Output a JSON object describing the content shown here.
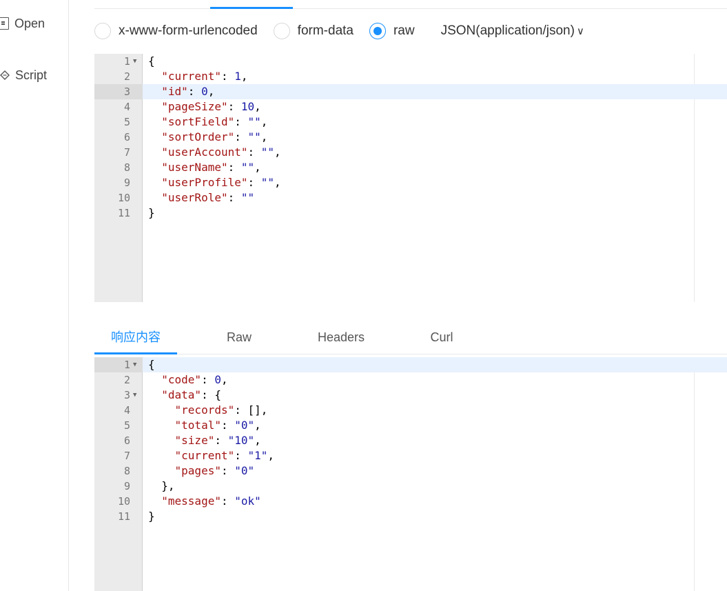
{
  "sidebar": {
    "items": [
      {
        "label": "Open",
        "icon": "document-icon"
      },
      {
        "label": "Script",
        "icon": "code-icon"
      }
    ]
  },
  "body_type": {
    "options": [
      {
        "label": "x-www-form-urlencoded",
        "checked": false
      },
      {
        "label": "form-data",
        "checked": false
      },
      {
        "label": "raw",
        "checked": true
      }
    ],
    "content_type": "JSON(application/json)"
  },
  "request_editor": {
    "lines": [
      {
        "n": "1",
        "text": "{"
      },
      {
        "n": "2",
        "text": "  \"current\": 1,"
      },
      {
        "n": "3",
        "text": "  \"id\": 0,"
      },
      {
        "n": "4",
        "text": "  \"pageSize\": 10,"
      },
      {
        "n": "5",
        "text": "  \"sortField\": \"\","
      },
      {
        "n": "6",
        "text": "  \"sortOrder\": \"\","
      },
      {
        "n": "7",
        "text": "  \"userAccount\": \"\","
      },
      {
        "n": "8",
        "text": "  \"userName\": \"\","
      },
      {
        "n": "9",
        "text": "  \"userProfile\": \"\","
      },
      {
        "n": "10",
        "text": "  \"userRole\": \"\""
      },
      {
        "n": "11",
        "text": "}"
      }
    ]
  },
  "response_tabs": [
    {
      "label": "响应内容",
      "active": true
    },
    {
      "label": "Raw",
      "active": false
    },
    {
      "label": "Headers",
      "active": false
    },
    {
      "label": "Curl",
      "active": false
    }
  ],
  "response_editor": {
    "lines": [
      {
        "n": "1",
        "text": "{"
      },
      {
        "n": "2",
        "text": "  \"code\": 0,"
      },
      {
        "n": "3",
        "text": "  \"data\": {"
      },
      {
        "n": "4",
        "text": "    \"records\": [],"
      },
      {
        "n": "5",
        "text": "    \"total\": \"0\","
      },
      {
        "n": "6",
        "text": "    \"size\": \"10\","
      },
      {
        "n": "7",
        "text": "    \"current\": \"1\","
      },
      {
        "n": "8",
        "text": "    \"pages\": \"0\""
      },
      {
        "n": "9",
        "text": "  },"
      },
      {
        "n": "10",
        "text": "  \"message\": \"ok\""
      },
      {
        "n": "11",
        "text": "}"
      }
    ]
  },
  "colors": {
    "accent": "#1890ff",
    "key": "#a31515",
    "string": "#1a1aa6",
    "active_line": "#e8f2fe"
  }
}
